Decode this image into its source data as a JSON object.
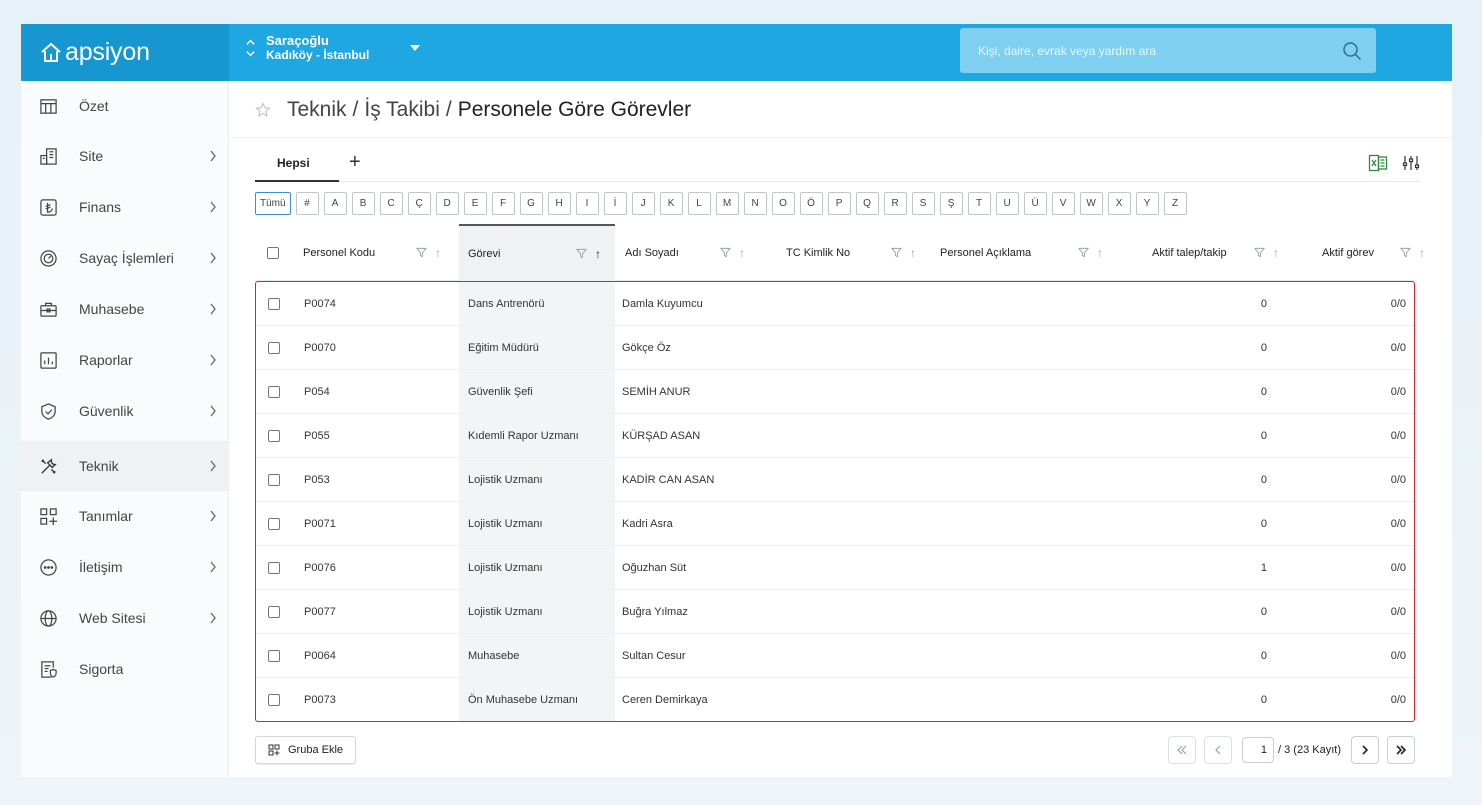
{
  "app": {
    "logo_text": "apsiyon"
  },
  "site": {
    "name": "Saraçoğlu",
    "location": "Kadıköy - İstanbul"
  },
  "search": {
    "placeholder": "Kişi, daire, evrak veya yardım ara"
  },
  "sidebar": {
    "items": [
      {
        "label": "Özet",
        "icon": "table-icon",
        "has_children": false
      },
      {
        "label": "Site",
        "icon": "building-icon",
        "has_children": true
      },
      {
        "label": "Finans",
        "icon": "lira-icon",
        "has_children": true
      },
      {
        "label": "Sayaç İşlemleri",
        "icon": "meter-icon",
        "has_children": true
      },
      {
        "label": "Muhasebe",
        "icon": "briefcase-icon",
        "has_children": true
      },
      {
        "label": "Raporlar",
        "icon": "report-icon",
        "has_children": true
      },
      {
        "label": "Güvenlik",
        "icon": "shield-icon",
        "has_children": true
      },
      {
        "label": "Teknik",
        "icon": "tools-icon",
        "has_children": true,
        "active": true
      },
      {
        "label": "Tanımlar",
        "icon": "grid-plus-icon",
        "has_children": true
      },
      {
        "label": "İletişim",
        "icon": "chat-icon",
        "has_children": true
      },
      {
        "label": "Web Sitesi",
        "icon": "globe-icon",
        "has_children": true
      },
      {
        "label": "Sigorta",
        "icon": "insurance-icon",
        "has_children": false
      }
    ]
  },
  "breadcrumb": {
    "part1": "Teknik",
    "sep": "/",
    "part2": "İş Takibi",
    "current": "Personele Göre Görevler"
  },
  "tabs": {
    "active": "Hepsi",
    "add": "+"
  },
  "letters": [
    "Tümü",
    "#",
    "A",
    "B",
    "C",
    "Ç",
    "D",
    "E",
    "F",
    "G",
    "H",
    "I",
    "İ",
    "J",
    "K",
    "L",
    "M",
    "N",
    "O",
    "Ö",
    "P",
    "Q",
    "R",
    "S",
    "Ş",
    "T",
    "U",
    "Ü",
    "V",
    "W",
    "X",
    "Y",
    "Z"
  ],
  "table": {
    "columns": [
      "Personel Kodu",
      "Görevi",
      "Adı Soyadı",
      "TC Kimlik No",
      "Personel Açıklama",
      "Aktif talep/takip",
      "Aktif görev"
    ],
    "rows": [
      {
        "code": "P0074",
        "role": "Dans Antrenörü",
        "name": "Damla Kuyumcu",
        "tc": "",
        "desc": "",
        "talep": "0",
        "gorev": "0/0"
      },
      {
        "code": "P0070",
        "role": "Eğitim Müdürü",
        "name": "Gökçe Öz",
        "tc": "",
        "desc": "",
        "talep": "0",
        "gorev": "0/0"
      },
      {
        "code": "P054",
        "role": "Güvenlik Şefi",
        "name": "SEMİH ANUR",
        "tc": "",
        "desc": "",
        "talep": "0",
        "gorev": "0/0"
      },
      {
        "code": "P055",
        "role": "Kıdemli Rapor Uzmanı",
        "name": "KÜRŞAD ASAN",
        "tc": "",
        "desc": "",
        "talep": "0",
        "gorev": "0/0"
      },
      {
        "code": "P053",
        "role": "Lojistik Uzmanı",
        "name": "KADİR CAN ASAN",
        "tc": "",
        "desc": "",
        "talep": "0",
        "gorev": "0/0"
      },
      {
        "code": "P0071",
        "role": "Lojistik Uzmanı",
        "name": "Kadri Asra",
        "tc": "",
        "desc": "",
        "talep": "0",
        "gorev": "0/0"
      },
      {
        "code": "P0076",
        "role": "Lojistik Uzmanı",
        "name": "Oğuzhan Süt",
        "tc": "",
        "desc": "",
        "talep": "1",
        "gorev": "0/0"
      },
      {
        "code": "P0077",
        "role": "Lojistik Uzmanı",
        "name": "Buğra Yılmaz",
        "tc": "",
        "desc": "",
        "talep": "0",
        "gorev": "0/0"
      },
      {
        "code": "P0064",
        "role": "Muhasebe",
        "name": "Sultan Cesur",
        "tc": "",
        "desc": "",
        "talep": "0",
        "gorev": "0/0"
      },
      {
        "code": "P0073",
        "role": "Ön Muhasebe Uzmanı",
        "name": "Ceren Demirkaya",
        "tc": "",
        "desc": "",
        "talep": "0",
        "gorev": "0/0"
      }
    ]
  },
  "footer": {
    "group_button": "Gruba Ekle",
    "page_current": "1",
    "page_total_text": "/ 3 (23 Kayıt)"
  },
  "colors": {
    "brand": "#1ea7e1",
    "brand_dark": "#1697cf",
    "selection_border": "#d9232e",
    "active_letter": "#3b8fd0"
  }
}
